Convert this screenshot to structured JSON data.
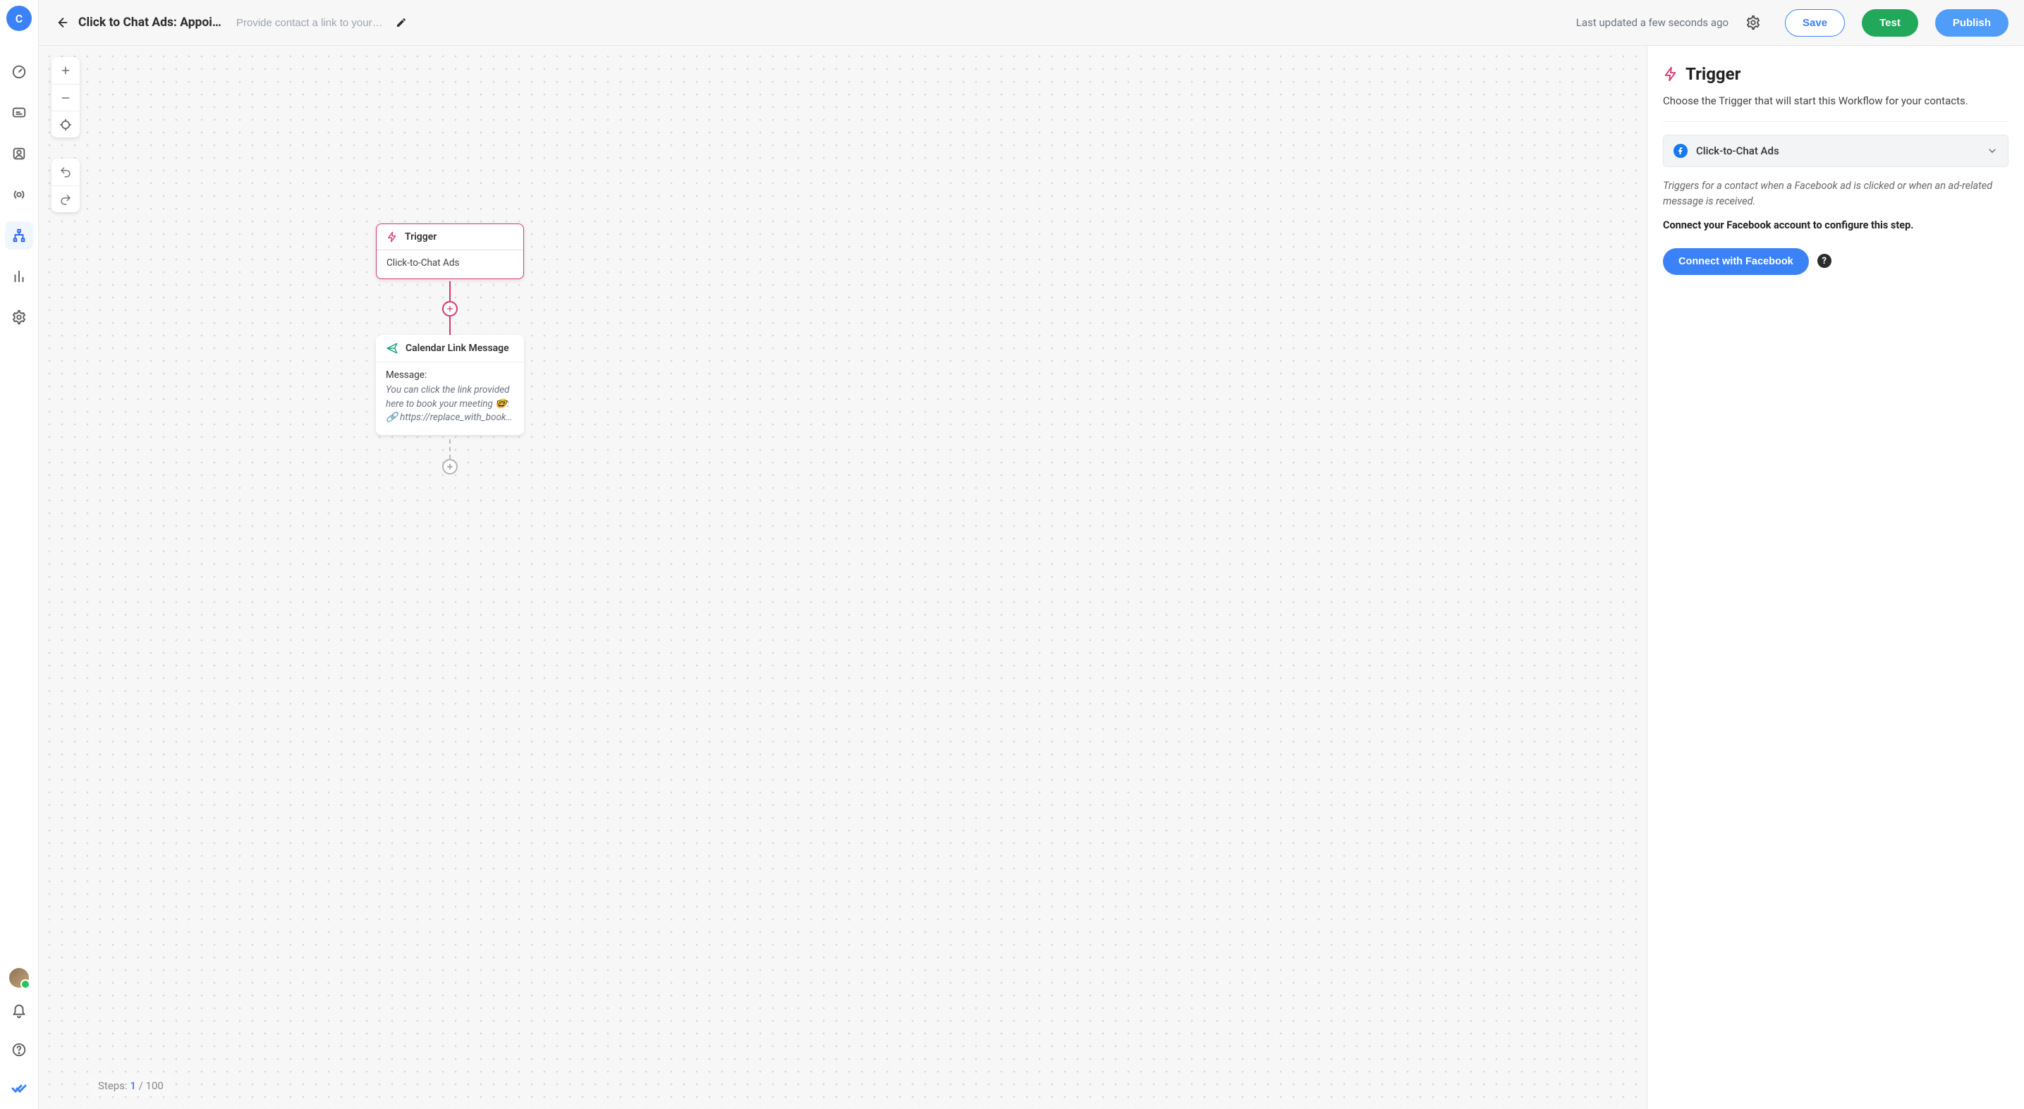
{
  "sidebar": {
    "avatar_letter": "C",
    "icons": [
      {
        "name": "dashboard-icon"
      },
      {
        "name": "inbox-icon"
      },
      {
        "name": "contacts-icon"
      },
      {
        "name": "broadcast-icon"
      },
      {
        "name": "workflows-icon",
        "active": true
      },
      {
        "name": "reports-icon"
      },
      {
        "name": "gear-icon"
      }
    ]
  },
  "header": {
    "title": "Click to Chat Ads: Appointme…",
    "description_placeholder": "Provide contact a link to your bu…",
    "last_updated": "Last updated a few seconds ago",
    "save_label": "Save",
    "test_label": "Test",
    "publish_label": "Publish"
  },
  "canvas": {
    "steps_label": "Steps:",
    "steps_current": "1",
    "steps_sep": "/",
    "steps_total": "100",
    "nodes": {
      "trigger": {
        "title": "Trigger",
        "subtitle": "Click-to-Chat Ads"
      },
      "message": {
        "title": "Calendar Link Message",
        "label": "Message:",
        "body_line1": "You can click the link provided here to book your meeting 🤓:",
        "body_line2": "🔗 https://replace_with_book…"
      }
    }
  },
  "panel": {
    "title": "Trigger",
    "subtitle": "Choose the Trigger that will start this Workflow for your contacts.",
    "select_label": "Click-to-Chat Ads",
    "description": "Triggers for a contact when a Facebook ad is clicked or when an ad-related message is received.",
    "connect_warning": "Connect your Facebook account to configure this step.",
    "connect_button": "Connect with Facebook",
    "help_char": "?"
  }
}
